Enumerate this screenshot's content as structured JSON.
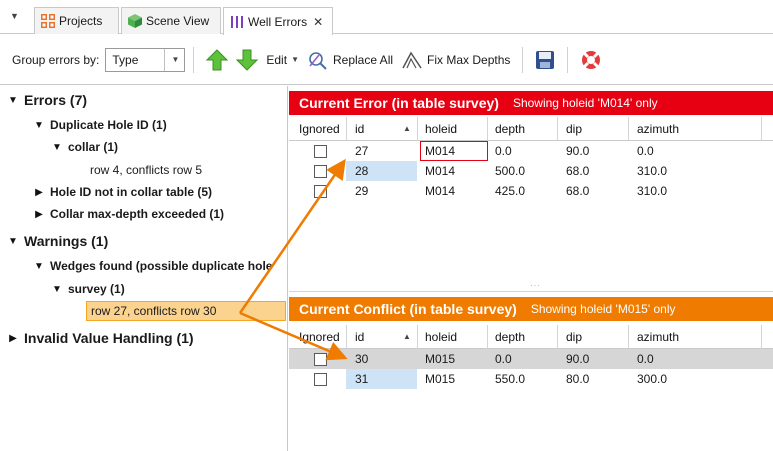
{
  "tabs": [
    {
      "label": "Projects",
      "icon": "grid-icon",
      "color": "#e8732a"
    },
    {
      "label": "Scene View",
      "icon": "cube-icon",
      "color": "#4caf50"
    },
    {
      "label": "Well Errors",
      "icon": "well-bars-icon",
      "color": "#7b3fbf",
      "active": true
    }
  ],
  "toolbar": {
    "group_label": "Group errors by:",
    "group_value": "Type",
    "edit_label": "Edit",
    "replace_all_label": "Replace All",
    "fix_max_depths_label": "Fix Max Depths"
  },
  "tree": {
    "errors": "Errors (7)",
    "duplicate_hole": "Duplicate Hole ID (1)",
    "collar": "collar (1)",
    "collar_row": "row 4, conflicts row 5",
    "hole_not_in_collar": "Hole ID not in collar table (5)",
    "collar_max_depth": "Collar max-depth exceeded (1)",
    "warnings": "Warnings (1)",
    "wedges": "Wedges found (possible duplicate hole",
    "survey": "survey (1)",
    "survey_row": "row 27, conflicts row 30",
    "invalid_value": "Invalid Value Handling (1)"
  },
  "current_error": {
    "title": "Current Error (in table survey)",
    "subtitle": "Showing holeid 'M014' only",
    "color": "#e60012",
    "columns": [
      "Ignored",
      "id",
      "holeid",
      "depth",
      "dip",
      "azimuth"
    ],
    "rows": [
      {
        "id": "27",
        "holeid": "M014",
        "depth": "0.0",
        "dip": "90.0",
        "azimuth": "0.0"
      },
      {
        "id": "28",
        "holeid": "M014",
        "depth": "500.0",
        "dip": "68.0",
        "azimuth": "310.0"
      },
      {
        "id": "29",
        "holeid": "M014",
        "depth": "425.0",
        "dip": "68.0",
        "azimuth": "310.0"
      }
    ]
  },
  "current_conflict": {
    "title": "Current Conflict (in table survey)",
    "subtitle": "Showing holeid 'M015' only",
    "color": "#ef7b00",
    "columns": [
      "Ignored",
      "id",
      "holeid",
      "depth",
      "dip",
      "azimuth"
    ],
    "rows": [
      {
        "id": "30",
        "holeid": "M015",
        "depth": "0.0",
        "dip": "90.0",
        "azimuth": "0.0"
      },
      {
        "id": "31",
        "holeid": "M015",
        "depth": "550.0",
        "dip": "80.0",
        "azimuth": "300.0"
      }
    ]
  },
  "annotation_color": "#ef7b00"
}
